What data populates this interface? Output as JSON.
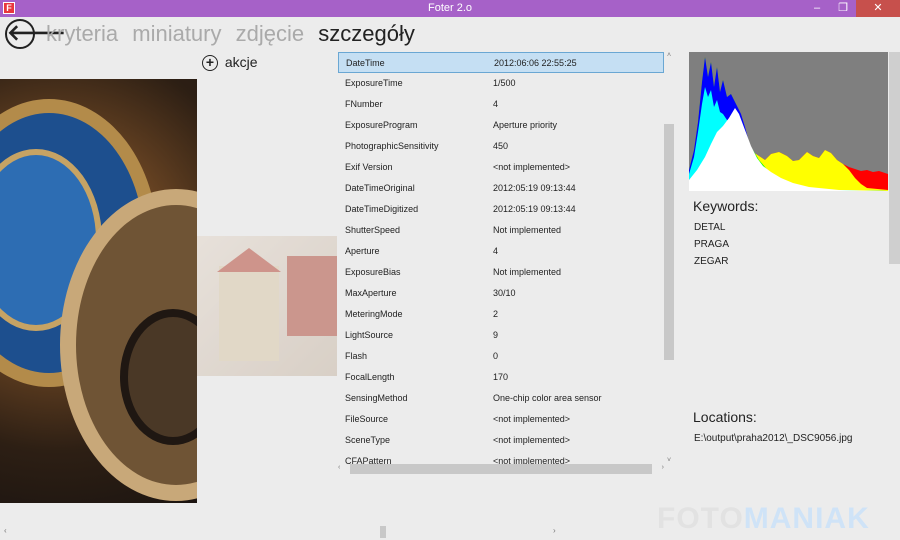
{
  "window": {
    "title": "Foter 2.o",
    "icon_letter": "F",
    "minimize": "‒",
    "maximize": "❐",
    "close": "✕"
  },
  "nav": {
    "back": "🡐",
    "items": [
      {
        "label": "kryteria",
        "active": false
      },
      {
        "label": "miniatury",
        "active": false
      },
      {
        "label": "zdjęcie",
        "active": false
      },
      {
        "label": "szczegóły",
        "active": true
      }
    ]
  },
  "actions": {
    "plus": "+",
    "label": "akcje"
  },
  "exif": [
    {
      "key": "DateTime",
      "value": "2012:06:06 22:55:25",
      "selected": true
    },
    {
      "key": "ExposureTime",
      "value": "1/500"
    },
    {
      "key": "FNumber",
      "value": "4"
    },
    {
      "key": "ExposureProgram",
      "value": "Aperture priority"
    },
    {
      "key": "PhotographicSensitivity",
      "value": "450"
    },
    {
      "key": "Exif Version",
      "value": "<not implemented>"
    },
    {
      "key": "DateTimeOriginal",
      "value": "2012:05:19 09:13:44"
    },
    {
      "key": "DateTimeDigitized",
      "value": "2012:05:19 09:13:44"
    },
    {
      "key": "ShutterSpeed",
      "value": "Not implemented"
    },
    {
      "key": "Aperture",
      "value": "4"
    },
    {
      "key": "ExposureBias",
      "value": "Not implemented"
    },
    {
      "key": "MaxAperture",
      "value": "30/10"
    },
    {
      "key": "MeteringMode",
      "value": "2"
    },
    {
      "key": "LightSource",
      "value": "9"
    },
    {
      "key": "Flash",
      "value": "0"
    },
    {
      "key": "FocalLength",
      "value": "170"
    },
    {
      "key": "SensingMethod",
      "value": "One-chip color area sensor"
    },
    {
      "key": "FileSource",
      "value": "<not implemented>"
    },
    {
      "key": "SceneType",
      "value": "<not implemented>"
    },
    {
      "key": "CFAPattern",
      "value": "<not implemented>"
    }
  ],
  "keywords": {
    "label": "Keywords:",
    "items": [
      "DETAL",
      "PRAGA",
      "ZEGAR"
    ]
  },
  "locations": {
    "label": "Locations:",
    "path": "E:\\output\\praha2012\\_DSC9056.jpg"
  },
  "watermark": {
    "part1": "FOTO",
    "part2": "MANIAK"
  },
  "colors": {
    "titlebar": "#a661c8",
    "close": "#c7504c",
    "selection": "#c5dff3",
    "background": "#ececec"
  }
}
